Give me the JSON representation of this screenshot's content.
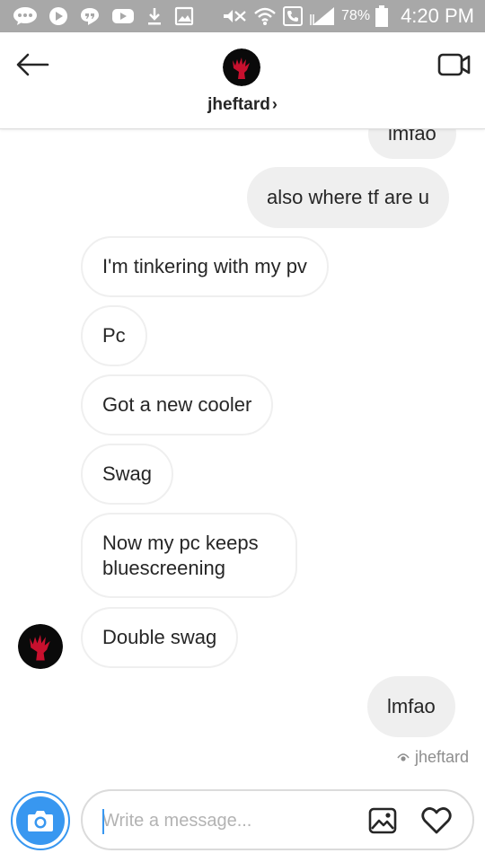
{
  "status_bar": {
    "battery_percent": "78%",
    "time": "4:20 PM",
    "icons": [
      "messenger-icon",
      "youtube-icon",
      "hangouts-icon",
      "youtube-icon",
      "download-icon",
      "gallery-icon",
      "mute-icon",
      "wifi-icon",
      "call-icon",
      "signal-icon",
      "battery-icon"
    ]
  },
  "header": {
    "username": "jheftard",
    "chevron": "›",
    "back_icon": "arrow-left-icon",
    "video_icon": "video-call-icon"
  },
  "messages": [
    {
      "side": "out",
      "text": "lmfao"
    },
    {
      "side": "out",
      "text": "also where tf are u"
    },
    {
      "side": "in",
      "text": "I'm tinkering with my pv"
    },
    {
      "side": "in",
      "text": "Pc"
    },
    {
      "side": "in",
      "text": "Got a new cooler"
    },
    {
      "side": "in",
      "text": "Swag"
    },
    {
      "side": "in",
      "text": "Now my pc keeps bluescreening"
    },
    {
      "side": "in",
      "text": "Double swag"
    },
    {
      "side": "out",
      "text": "lmfao"
    }
  ],
  "seen": {
    "label": "jheftard",
    "icon": "eye-icon"
  },
  "composer": {
    "placeholder": "Write a message...",
    "value": "",
    "camera_icon": "camera-icon",
    "gallery_icon": "image-icon",
    "like_icon": "heart-icon"
  },
  "colors": {
    "status_bar": "#a8a8a8",
    "accent": "#3897f0",
    "outgoing_bubble": "#efefef",
    "incoming_border": "#efefef",
    "avatar_hand": "#c8102e"
  }
}
